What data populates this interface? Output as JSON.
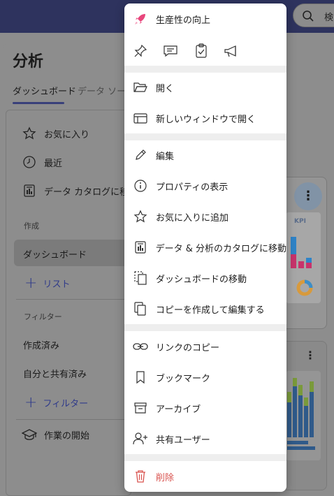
{
  "header": {
    "search_placeholder": "検"
  },
  "page": {
    "title": "分析",
    "tabs": [
      {
        "label": "ダッシュボード"
      },
      {
        "label": "データ ソース"
      }
    ]
  },
  "sidebar": {
    "items": [
      {
        "label": "お気に入り",
        "icon": "star-icon"
      },
      {
        "label": "最近",
        "icon": "clock-icon"
      },
      {
        "label": "データ カタログに移動",
        "icon": "catalog-icon"
      }
    ],
    "section_create": "作成",
    "active_item": "ダッシュボード",
    "add_list": "リスト",
    "section_filter": "フィルター",
    "filters": [
      {
        "label": "作成済み"
      },
      {
        "label": "自分と共有済み"
      }
    ],
    "add_filter": "フィルター",
    "get_started": "作業の開始"
  },
  "card": {
    "kpi_label": "KPI"
  },
  "menu": {
    "productivity": "生産性の向上",
    "quick_actions": [
      "pin-icon",
      "comment-icon",
      "clipboard-check-icon",
      "megaphone-icon"
    ],
    "items": [
      {
        "label": "開く",
        "icon": "folder-open-icon"
      },
      {
        "label": "新しいウィンドウで開く",
        "icon": "new-window-icon"
      },
      {
        "label": "編集",
        "icon": "pencil-icon"
      },
      {
        "label": "プロパティの表示",
        "icon": "info-icon"
      },
      {
        "label": "お気に入りに追加",
        "icon": "star-icon"
      },
      {
        "label": "データ & 分析のカタログに移動",
        "icon": "catalog-icon"
      },
      {
        "label": "ダッシュボードの移動",
        "icon": "move-icon"
      },
      {
        "label": "コピーを作成して編集する",
        "icon": "copy-icon"
      },
      {
        "label": "リンクのコピー",
        "icon": "link-icon"
      },
      {
        "label": "ブックマーク",
        "icon": "bookmark-icon"
      },
      {
        "label": "アーカイブ",
        "icon": "archive-icon"
      },
      {
        "label": "共有ユーザー",
        "icon": "share-user-icon"
      },
      {
        "label": "削除",
        "icon": "trash-icon"
      }
    ]
  },
  "colors": {
    "accent": "#2e335e",
    "delete": "#d9534f",
    "rocket": "#e8467c"
  }
}
